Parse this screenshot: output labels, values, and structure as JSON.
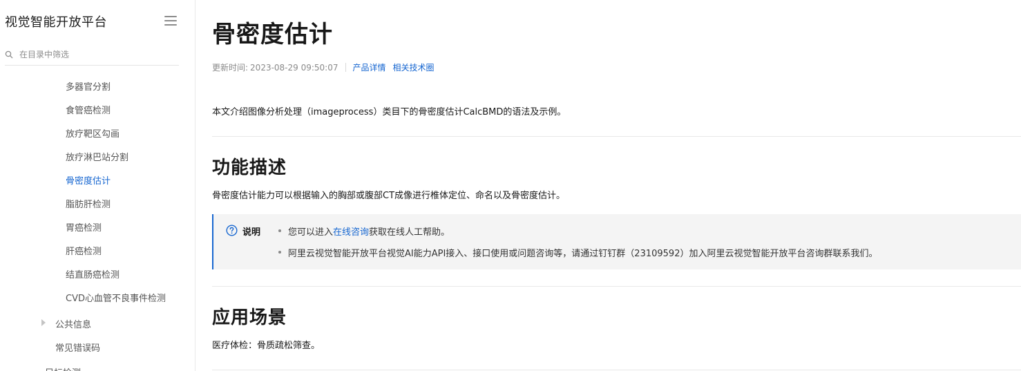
{
  "sidebar": {
    "app_title": "视觉智能开放平台",
    "filter_placeholder": "在目录中筛选",
    "items": [
      {
        "label": "多器官分割"
      },
      {
        "label": "食管癌检测"
      },
      {
        "label": "放疗靶区勾画"
      },
      {
        "label": "放疗淋巴站分割"
      },
      {
        "label": "骨密度估计",
        "active": true
      },
      {
        "label": "脂肪肝检测"
      },
      {
        "label": "胃癌检测"
      },
      {
        "label": "肝癌检测"
      },
      {
        "label": "结直肠癌检测"
      },
      {
        "label": "CVD心血管不良事件检测"
      }
    ],
    "group_public_info": "公共信息",
    "common_errors": "常见错误码",
    "partial_item": "目标检测"
  },
  "main": {
    "title": "骨密度估计",
    "meta": {
      "updated_label": "更新时间:",
      "updated_value": "2023-08-29 09:50:07",
      "link_product": "产品详情",
      "link_tech": "相关技术圈"
    },
    "intro": "本文介绍图像分析处理（imageprocess）类目下的骨密度估计CalcBMD的语法及示例。",
    "section_function": {
      "heading": "功能描述",
      "text": "骨密度估计能力可以根据输入的胸部或腹部CT成像进行椎体定位、命名以及骨密度估计。"
    },
    "note": {
      "label": "说明",
      "item1_before": "您可以进入",
      "item1_link": "在线咨询",
      "item1_after": "获取在线人工帮助。",
      "item2": "阿里云视觉智能开放平台视觉AI能力API接入、接口使用或问题咨询等，请通过钉钉群（23109592）加入阿里云视觉智能开放平台咨询群联系我们。"
    },
    "section_scenario": {
      "heading": "应用场景",
      "text": "医疗体检：骨质疏松筛查。"
    }
  },
  "colors": {
    "accent": "#1666d0",
    "text": "#181818",
    "muted": "#8a8a8a",
    "note_bg": "#f4f4f4"
  }
}
